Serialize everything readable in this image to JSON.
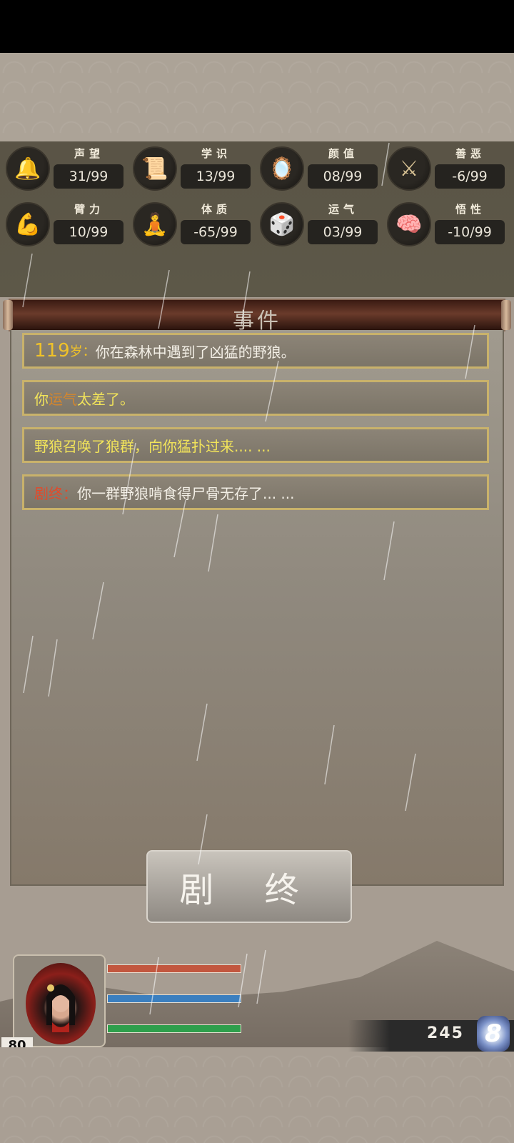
{
  "stats": [
    {
      "icon": "bell-icon",
      "glyph": "🔔",
      "label": "声望",
      "value": "31/99"
    },
    {
      "icon": "scroll-icon",
      "glyph": "📜",
      "label": "学识",
      "value": "13/99"
    },
    {
      "icon": "mirror-icon",
      "glyph": "🪞",
      "label": "颜值",
      "value": "08/99"
    },
    {
      "icon": "crossed-swords-icon",
      "glyph": "⚔",
      "label": "善恶",
      "value": "-6/99"
    },
    {
      "icon": "arm-icon",
      "glyph": "💪",
      "label": "臂力",
      "value": "10/99"
    },
    {
      "icon": "meditation-icon",
      "glyph": "🧘",
      "label": "体质",
      "value": "-65/99"
    },
    {
      "icon": "dice-icon",
      "glyph": "🎲",
      "label": "运气",
      "value": "03/99"
    },
    {
      "icon": "brain-icon",
      "glyph": "🧠",
      "label": "悟性",
      "value": "-10/99"
    }
  ],
  "events_title": "事件",
  "events": {
    "e1": {
      "age": "119",
      "age_unit": "岁：",
      "text": "你在森林中遇到了凶猛的野狼。"
    },
    "e2": {
      "pre": "你",
      "highlight": "运气",
      "post": "太差了。"
    },
    "e3": {
      "text": "野狼召唤了狼群，向你猛扑过来.... ..."
    },
    "e4": {
      "prefix": "剧终：",
      "text": "你一群野狼啃食得尸骨无存了... ..."
    }
  },
  "end_button": "剧 终",
  "character": {
    "level": "80"
  },
  "currency": {
    "value": "245",
    "icon_glyph": "8"
  },
  "bars": [
    {
      "name": "health",
      "color": "#c2573f",
      "fill": 1.0
    },
    {
      "name": "mana",
      "color": "#3b7fbf",
      "fill": 1.0
    },
    {
      "name": "stamina",
      "color": "#2e9f4c",
      "fill": 1.0
    }
  ]
}
